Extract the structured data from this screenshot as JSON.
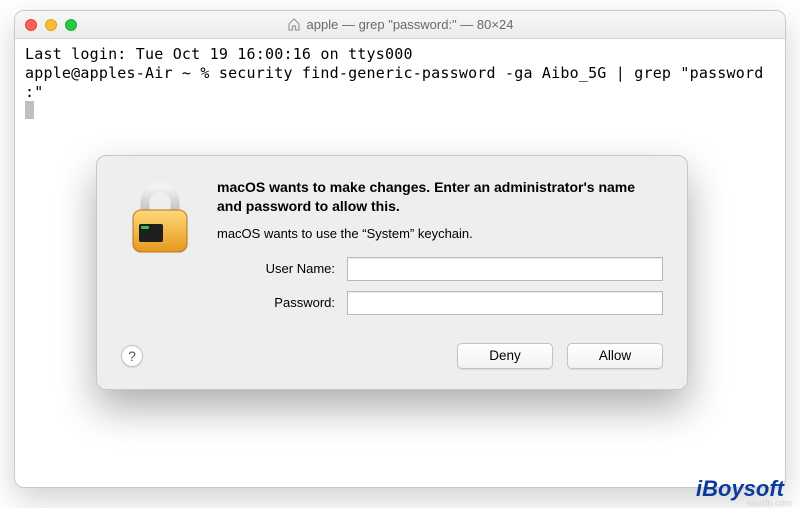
{
  "window": {
    "title": "apple — grep \"password:\" — 80×24"
  },
  "terminal": {
    "last_login": "Last login: Tue Oct 19 16:00:16 on ttys000",
    "prompt_line": "apple@apples-Air ~ % security find-generic-password -ga Aibo_5G | grep \"password",
    "prompt_line2": ":\""
  },
  "dialog": {
    "heading": "macOS wants to make changes. Enter an administrator's name and password to allow this.",
    "subtext": "macOS wants to use the “System” keychain.",
    "username_label": "User Name:",
    "password_label": "Password:",
    "username_value": "",
    "password_value": "",
    "help_label": "?",
    "deny_label": "Deny",
    "allow_label": "Allow"
  },
  "watermark": {
    "brand": "iBoysoft",
    "source": "wsxdn.com"
  }
}
